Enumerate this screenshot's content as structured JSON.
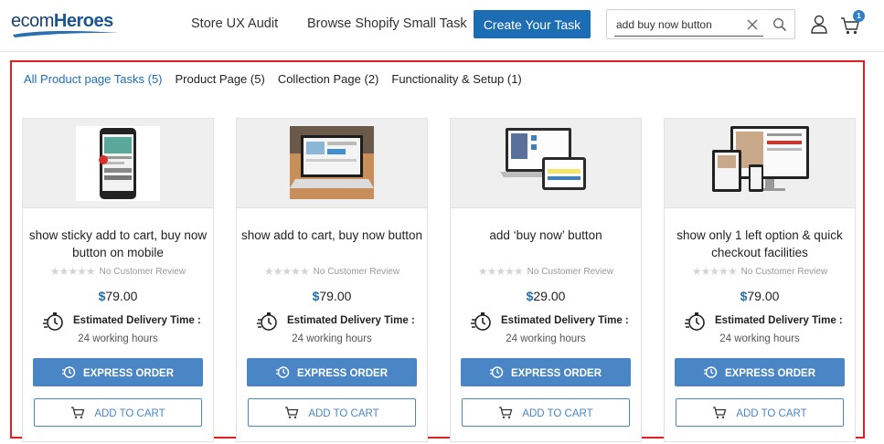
{
  "brand": {
    "logo_part1": "ecom",
    "logo_part2": "Heroes"
  },
  "nav": {
    "links": [
      "Store UX Audit",
      "Browse Shopify Small Task"
    ],
    "create_label": "Create Your Task"
  },
  "search": {
    "value": "add buy now button"
  },
  "cart": {
    "count": "1"
  },
  "tabs": [
    {
      "label": "All Product page Tasks",
      "count": "(5)",
      "active": true
    },
    {
      "label": "Product Page",
      "count": "(5)"
    },
    {
      "label": "Collection Page",
      "count": "(2)"
    },
    {
      "label": "Functionality & Setup",
      "count": "(1)"
    }
  ],
  "products": [
    {
      "title": "show sticky add to cart, buy now button on mobile",
      "currency": "$",
      "price": "79.00",
      "image": "phone-mockup"
    },
    {
      "title": "show add to cart, buy now button",
      "currency": "$",
      "price": "79.00",
      "image": "laptop-photo"
    },
    {
      "title": "add ‘buy now’ button",
      "currency": "$",
      "price": "29.00",
      "image": "laptop-tablet-mockup"
    },
    {
      "title": "show only 1 left option & quick checkout facilities",
      "currency": "$",
      "price": "79.00",
      "image": "multi-device-mockup"
    }
  ],
  "labels": {
    "no_review": "No Customer Review",
    "delivery_label": "Estimated Delivery Time :",
    "delivery_value": "24 working hours",
    "express": "EXPRESS ORDER",
    "add_to_cart": "ADD TO CART"
  },
  "colors": {
    "brand": "#1d6db5",
    "button": "#4a86c5",
    "highlight_frame": "#e02020"
  },
  "icons": [
    "close-icon",
    "search-icon",
    "user-icon",
    "cart-icon",
    "star-icon",
    "stopwatch-icon",
    "express-icon"
  ]
}
